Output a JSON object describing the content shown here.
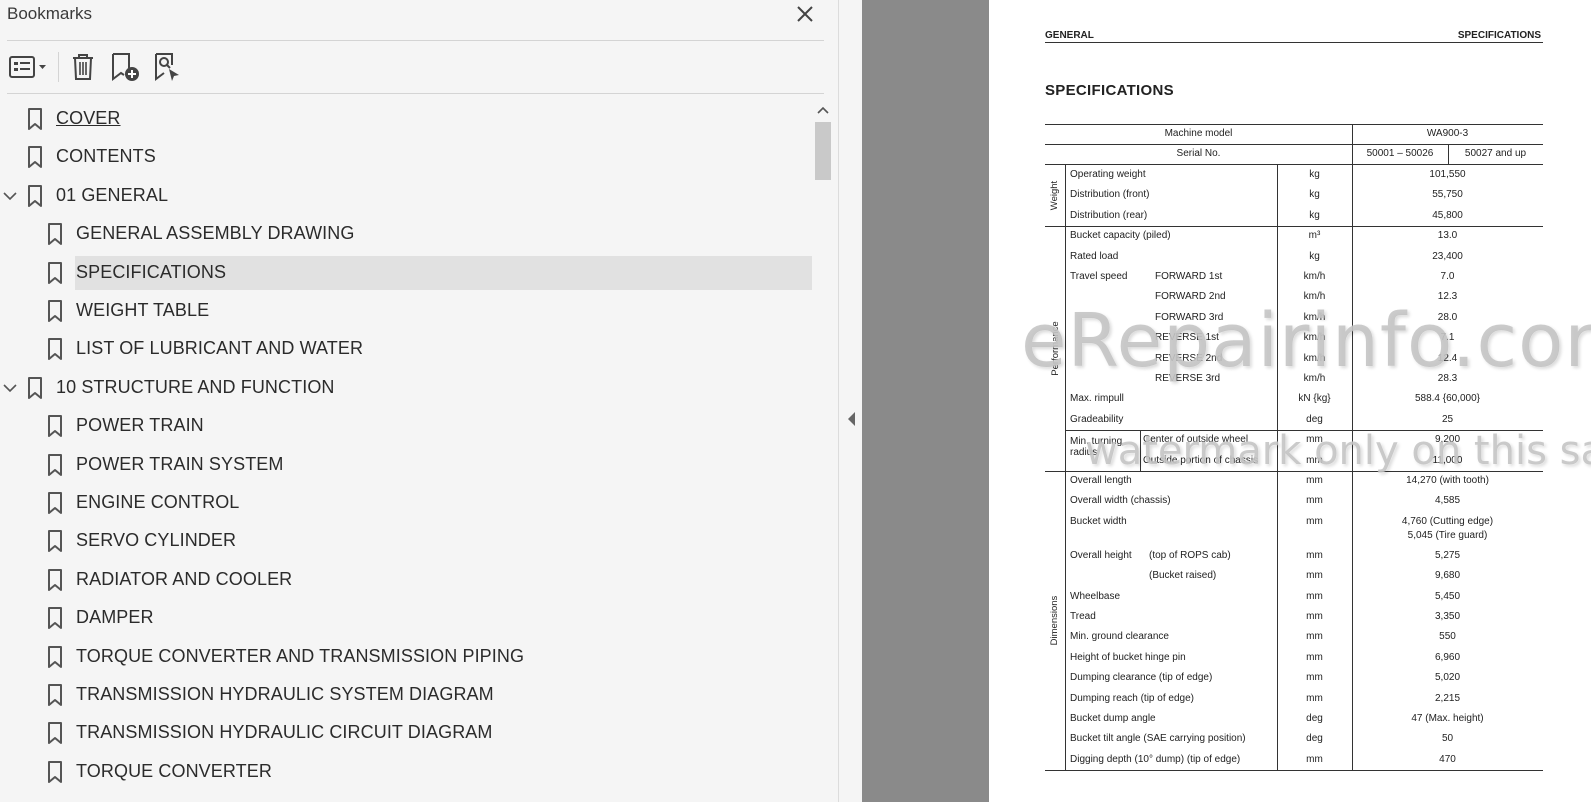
{
  "panel": {
    "title": "Bookmarks",
    "close_icon": "close-icon",
    "toolbar": [
      {
        "name": "options-menu",
        "icon": "list-options-icon"
      },
      {
        "name": "delete-bookmark",
        "icon": "trash-icon"
      },
      {
        "name": "add-bookmark",
        "icon": "add-bookmark-icon"
      },
      {
        "name": "find-current-bookmark",
        "icon": "find-bookmark-icon"
      }
    ]
  },
  "bookmarks": [
    {
      "label": "COVER",
      "level": 0,
      "link": true
    },
    {
      "label": "CONTENTS",
      "level": 0
    },
    {
      "label": "01 GENERAL",
      "level": 0,
      "expanded": true
    },
    {
      "label": "GENERAL ASSEMBLY DRAWING",
      "level": 1
    },
    {
      "label": "SPECIFICATIONS",
      "level": 1,
      "selected": true
    },
    {
      "label": "WEIGHT TABLE",
      "level": 1
    },
    {
      "label": "LIST OF LUBRICANT AND WATER",
      "level": 1
    },
    {
      "label": "10 STRUCTURE AND FUNCTION",
      "level": 0,
      "expanded": true
    },
    {
      "label": "POWER TRAIN",
      "level": 1
    },
    {
      "label": "POWER TRAIN SYSTEM",
      "level": 1
    },
    {
      "label": "ENGINE CONTROL",
      "level": 1
    },
    {
      "label": "SERVO CYLINDER",
      "level": 1
    },
    {
      "label": "RADIATOR AND COOLER",
      "level": 1
    },
    {
      "label": "DAMPER",
      "level": 1
    },
    {
      "label": "TORQUE CONVERTER AND TRANSMISSION PIPING",
      "level": 1
    },
    {
      "label": "TRANSMISSION HYDRAULIC SYSTEM DIAGRAM",
      "level": 1
    },
    {
      "label": "TRANSMISSION HYDRAULIC CIRCUIT DIAGRAM",
      "level": 1
    },
    {
      "label": "TORQUE CONVERTER",
      "level": 1
    }
  ],
  "document": {
    "header_left": "GENERAL",
    "header_right": "SPECIFICATIONS",
    "title": "SPECIFICATIONS",
    "table": {
      "machine_model_label": "Machine model",
      "machine_model_value": "WA900-3",
      "serial_label": "Serial No.",
      "serial_a": "50001 – 50026",
      "serial_b": "50027 and up",
      "groups": {
        "weight": "Weight",
        "performance": "Performance",
        "dimensions": "Dimensions"
      },
      "rows": [
        {
          "item": "Operating weight",
          "unit": "kg",
          "value": "101,550"
        },
        {
          "item": "Distribution (front)",
          "unit": "kg",
          "value": "55,750"
        },
        {
          "item": "Distribution (rear)",
          "unit": "kg",
          "value": "45,800"
        },
        {
          "item": "Bucket capacity (piled)",
          "unit": "m³",
          "value": "13.0"
        },
        {
          "item": "Rated load",
          "unit": "kg",
          "value": "23,400"
        },
        {
          "item": "Travel speed",
          "sub": "FORWARD 1st",
          "unit": "km/h",
          "value": "7.0"
        },
        {
          "item": "",
          "sub": "FORWARD 2nd",
          "unit": "km/h",
          "value": "12.3"
        },
        {
          "item": "",
          "sub": "FORWARD 3rd",
          "unit": "km/h",
          "value": "28.0"
        },
        {
          "item": "",
          "sub": "REVERSE 1st",
          "unit": "km/h",
          "value": "7.1"
        },
        {
          "item": "",
          "sub": "REVERSE 2nd",
          "unit": "km/h",
          "value": "12.4"
        },
        {
          "item": "",
          "sub": "REVERSE 3rd",
          "unit": "km/h",
          "value": "28.3"
        },
        {
          "item": "Max. rimpull",
          "unit": "kN {kg}",
          "value": "588.4 {60,000}"
        },
        {
          "item": "Gradeability",
          "unit": "deg",
          "value": "25"
        },
        {
          "item": "Min. turning radius",
          "sub": "Center of outside wheel",
          "unit": "mm",
          "value": "9,200"
        },
        {
          "item": "",
          "sub": "Outside portion of chassis",
          "unit": "mm",
          "value": "11,000"
        },
        {
          "item": "Overall length",
          "unit": "mm",
          "value": "14,270 (with tooth)"
        },
        {
          "item": "Overall width (chassis)",
          "unit": "mm",
          "value": "4,585"
        },
        {
          "item": "Bucket width",
          "unit": "mm",
          "value": "4,760 (Cutting edge)",
          "value2": "5,045 (Tire guard)"
        },
        {
          "item": "Overall height",
          "sub": "(top of ROPS cab)",
          "unit": "mm",
          "value": "5,275"
        },
        {
          "item": "",
          "sub": "(Bucket raised)",
          "unit": "mm",
          "value": "9,680"
        },
        {
          "item": "Wheelbase",
          "unit": "mm",
          "value": "5,450"
        },
        {
          "item": "Tread",
          "unit": "mm",
          "value": "3,350"
        },
        {
          "item": "Min. ground clearance",
          "unit": "mm",
          "value": "550"
        },
        {
          "item": "Height of bucket hinge pin",
          "unit": "mm",
          "value": "6,960"
        },
        {
          "item": "Dumping clearance (tip of edge)",
          "unit": "mm",
          "value": "5,020"
        },
        {
          "item": "Dumping reach (tip of edge)",
          "unit": "mm",
          "value": "2,215"
        },
        {
          "item": "Bucket dump angle",
          "unit": "deg",
          "value": "47 (Max. height)"
        },
        {
          "item": "Bucket tilt angle (SAE carrying position)",
          "unit": "deg",
          "value": "50"
        },
        {
          "item": "Digging depth (10° dump) (tip of edge)",
          "unit": "mm",
          "value": "470"
        }
      ]
    },
    "watermark_main": "eRepairinfo.com",
    "watermark_sub": "watermark only on this sample"
  }
}
